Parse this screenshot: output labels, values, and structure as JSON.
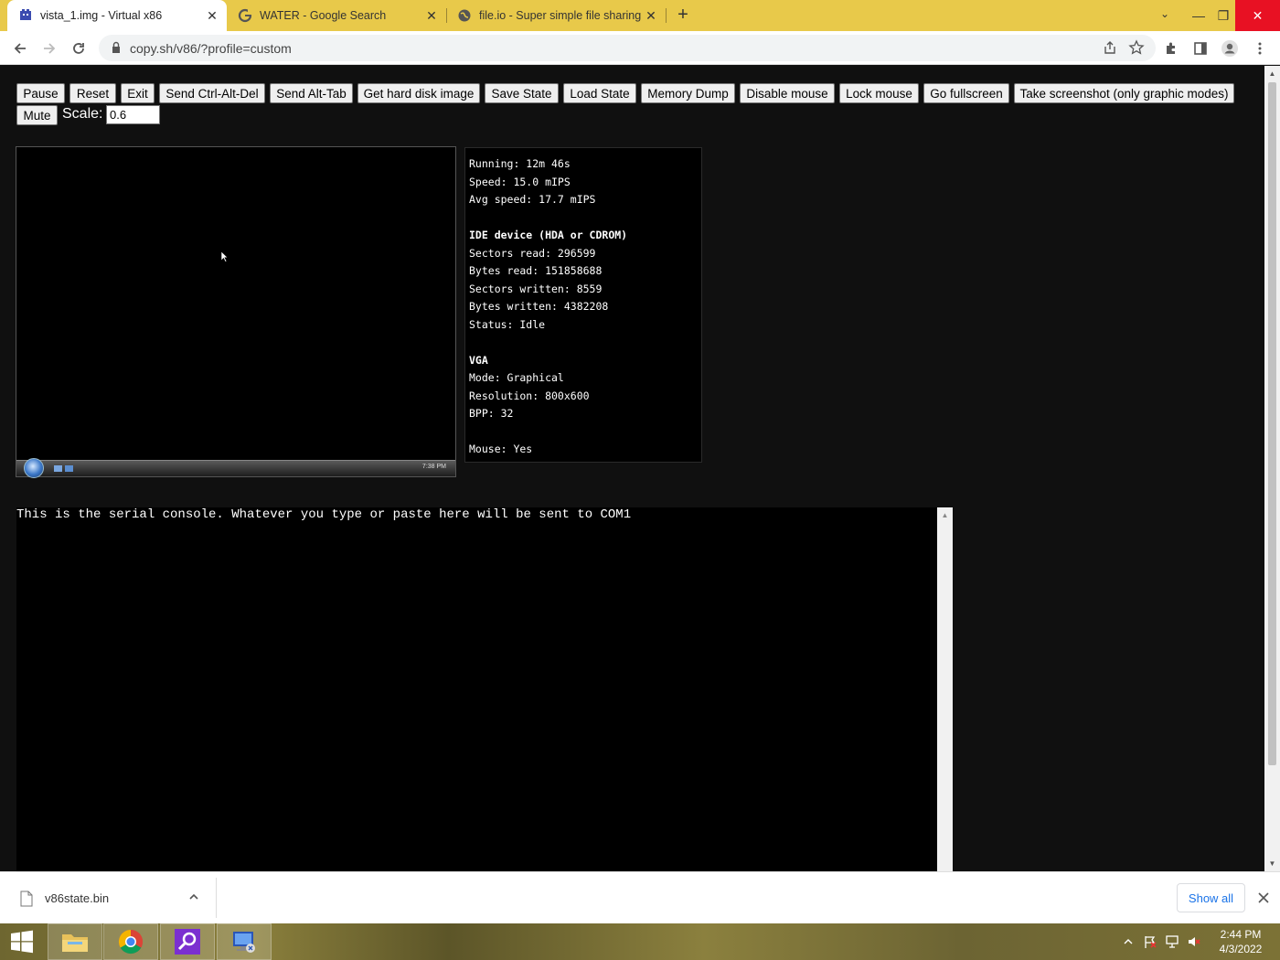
{
  "browser": {
    "tabs": [
      {
        "title": "vista_1.img - Virtual x86",
        "active": true,
        "favicon": "v86-icon"
      },
      {
        "title": "WATER - Google Search",
        "active": false,
        "favicon": "google-icon"
      },
      {
        "title": "file.io - Super simple file sharing",
        "active": false,
        "favicon": "globe-icon"
      }
    ],
    "url": "copy.sh/v86/?profile=custom",
    "accent_color": "#e8c94a"
  },
  "controls": {
    "buttons": [
      "Pause",
      "Reset",
      "Exit",
      "Send Ctrl-Alt-Del",
      "Send Alt-Tab",
      "Get hard disk image",
      "Save State",
      "Load State",
      "Memory Dump",
      "Disable mouse",
      "Lock mouse",
      "Go fullscreen",
      "Take screenshot (only graphic modes)"
    ],
    "mute": "Mute",
    "scale_label": "Scale:",
    "scale_value": "0.6"
  },
  "vm_screen": {
    "clock": "7:38 PM"
  },
  "info": {
    "running": "Running: 12m 46s",
    "speed": "Speed: 15.0 mIPS",
    "avg_speed": "Avg speed: 17.7 mIPS",
    "ide_heading": "IDE device (HDA or CDROM)",
    "sectors_read": "Sectors read: 296599",
    "bytes_read": "Bytes read: 151858688",
    "sectors_written": "Sectors written: 8559",
    "bytes_written": "Bytes written: 4382208",
    "status": "Status: Idle",
    "vga_heading": "VGA",
    "mode": "Mode: Graphical",
    "resolution": "Resolution: 800x600",
    "bpp": "BPP: 32",
    "mouse": "Mouse: Yes"
  },
  "serial_console": {
    "text": "This is the serial console. Whatever you type or paste here will be sent to COM1"
  },
  "download_shelf": {
    "file_name": "v86state.bin",
    "show_all": "Show all"
  },
  "taskbar": {
    "time": "2:44 PM",
    "date": "4/3/2022"
  }
}
